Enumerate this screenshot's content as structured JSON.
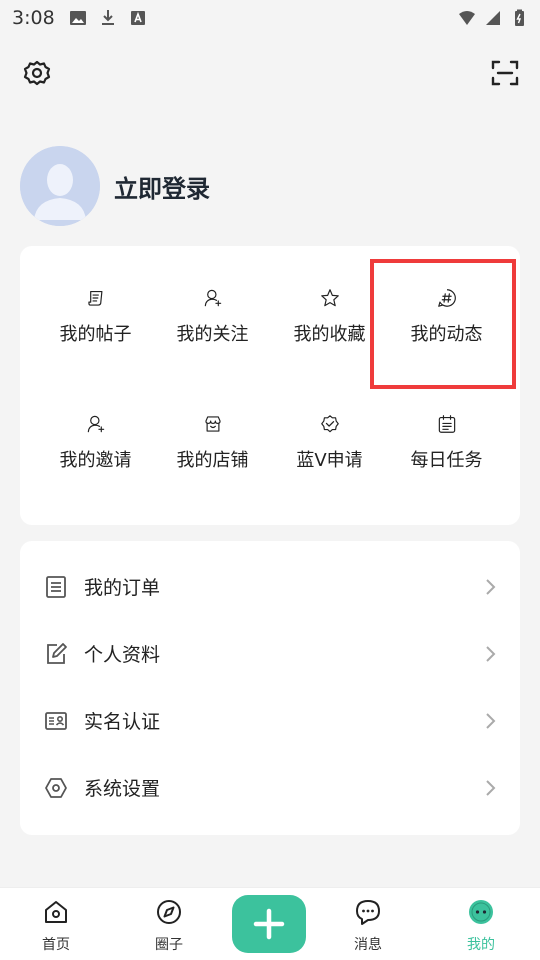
{
  "status_bar": {
    "time": "3:08"
  },
  "profile": {
    "login_label": "立即登录"
  },
  "grid": {
    "items": [
      {
        "label": "我的帖子",
        "icon": "post-icon"
      },
      {
        "label": "我的关注",
        "icon": "follow-user-icon"
      },
      {
        "label": "我的收藏",
        "icon": "star-icon"
      },
      {
        "label": "我的动态",
        "icon": "hashtag-chat-icon"
      },
      {
        "label": "我的邀请",
        "icon": "invite-user-icon"
      },
      {
        "label": "我的店铺",
        "icon": "store-icon"
      },
      {
        "label": "蓝V申请",
        "icon": "verified-badge-icon"
      },
      {
        "label": "每日任务",
        "icon": "calendar-task-icon"
      }
    ]
  },
  "list": {
    "items": [
      {
        "label": "我的订单",
        "icon": "order-list-icon"
      },
      {
        "label": "个人资料",
        "icon": "edit-document-icon"
      },
      {
        "label": "实名认证",
        "icon": "id-card-icon"
      },
      {
        "label": "系统设置",
        "icon": "hexagon-settings-icon"
      }
    ]
  },
  "tabbar": {
    "tabs": [
      {
        "label": "首页",
        "icon": "home-icon"
      },
      {
        "label": "圈子",
        "icon": "compass-icon"
      },
      {
        "label": "消息",
        "icon": "chat-icon"
      },
      {
        "label": "我的",
        "icon": "profile-face-icon"
      }
    ],
    "add_icon": "plus-icon"
  },
  "colors": {
    "accent": "#3cc29d",
    "highlight": "#ef3b3b"
  }
}
